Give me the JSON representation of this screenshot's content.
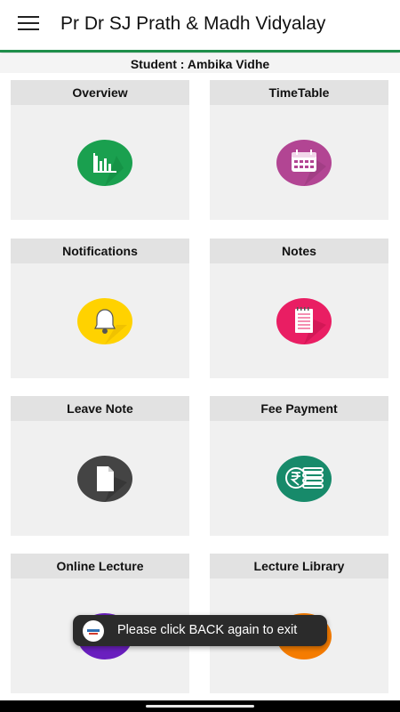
{
  "header": {
    "title": "Pr Dr SJ Prath & Madh Vidyalay",
    "menu_icon": "hamburger-menu-icon",
    "accent_color": "#1e8e4a"
  },
  "student_bar": {
    "text": "Student : Ambika Vidhe"
  },
  "tiles": [
    {
      "label": "Overview",
      "icon": "bar-chart-icon",
      "color": "#1aa04f"
    },
    {
      "label": "TimeTable",
      "icon": "calendar-icon",
      "color": "#b24593"
    },
    {
      "label": "Notifications",
      "icon": "bell-icon",
      "color": "#ffd200"
    },
    {
      "label": "Notes",
      "icon": "notepad-icon",
      "color": "#e91e63"
    },
    {
      "label": "Leave Note",
      "icon": "document-icon",
      "color": "#444444"
    },
    {
      "label": "Fee Payment",
      "icon": "rupee-coins-icon",
      "color": "#178a6a"
    },
    {
      "label": "Online Lecture",
      "icon": "video-icon",
      "color": "#6a1fbf"
    },
    {
      "label": "Lecture Library",
      "icon": "library-icon",
      "color": "#f57c00"
    }
  ],
  "toast": {
    "text": "Please click BACK again to exit",
    "logo_icon": "app-logo-icon"
  }
}
